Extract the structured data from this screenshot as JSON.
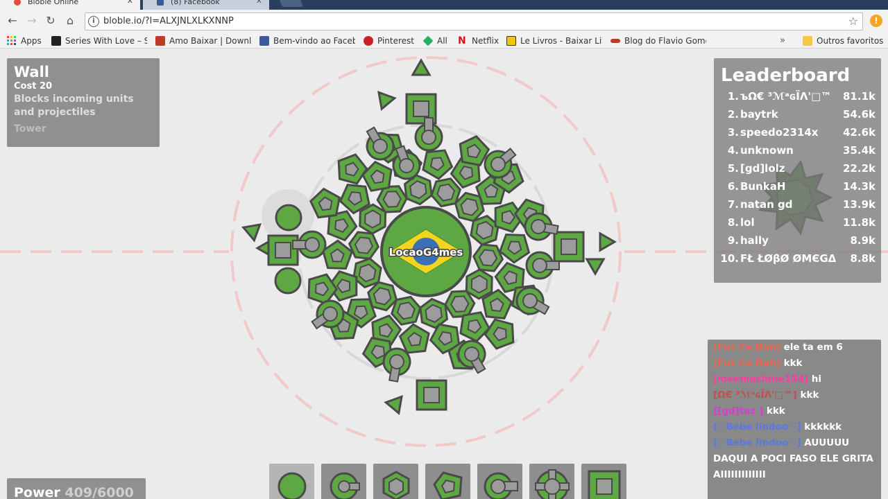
{
  "browser": {
    "tabs": [
      {
        "title": "Bloble Online",
        "active": true
      },
      {
        "title": "(8) Facebook",
        "active": false
      }
    ],
    "url": "bloble.io/?l=ALXJNLXLKXNNP",
    "bookmarks": [
      {
        "label": "Apps",
        "icon": "apps-grid-icon"
      },
      {
        "label": "Series With Love – Se",
        "icon": "film-icon"
      },
      {
        "label": "Amo Baixar | Downlo",
        "icon": "heart-icon"
      },
      {
        "label": "Bem-vindo ao Facebo",
        "icon": "facebook-icon"
      },
      {
        "label": "Pinterest",
        "icon": "pinterest-icon"
      },
      {
        "label": "All",
        "icon": "diamond-icon"
      },
      {
        "label": "Netflix",
        "icon": "netflix-icon"
      },
      {
        "label": "Le Livros - Baixar Livr",
        "icon": "book-icon"
      },
      {
        "label": "Blog do Flavio Gome",
        "icon": "car-icon"
      }
    ],
    "bookmarks_more": "»",
    "other_bookmarks": "Outros favoritos"
  },
  "info_panel": {
    "title": "Wall",
    "cost": "Cost 20",
    "description": "Blocks incoming units and projectiles",
    "type": "Tower"
  },
  "leaderboard": {
    "title": "Leaderboard",
    "rows": [
      {
        "rank": "1.",
        "name": "ъΩ€ ³ℳᵃɢЇΛ'□™",
        "score": "81.1k"
      },
      {
        "rank": "2.",
        "name": "baytrk",
        "score": "54.6k"
      },
      {
        "rank": "3.",
        "name": "speedo2314x",
        "score": "42.6k"
      },
      {
        "rank": "4.",
        "name": "unknown",
        "score": "35.4k"
      },
      {
        "rank": "5.",
        "name": "[gd]lolz",
        "score": "22.2k"
      },
      {
        "rank": "6.",
        "name": "BunkaH",
        "score": "14.3k"
      },
      {
        "rank": "7.",
        "name": "natan gd",
        "score": "13.9k"
      },
      {
        "rank": "8.",
        "name": "lol",
        "score": "11.8k"
      },
      {
        "rank": "9.",
        "name": "hally",
        "score": "8.9k"
      },
      {
        "rank": "10.",
        "name": "FŁ ŁØβØ ØMЄGΔ",
        "score": "8.8k"
      }
    ]
  },
  "chat": [
    {
      "author": "[Fus Ca Dah]",
      "text": " ele ta em 6",
      "color": "#e8634c"
    },
    {
      "author": "[Fus Ca Dah]",
      "text": " kkk",
      "color": "#e8634c"
    },
    {
      "author": "[meemachine184]",
      "text": " hi",
      "color": "#ff3ea5"
    },
    {
      "author": "[ΩЄ ³ℳᵃɢЇΛ'□™]",
      "text": " kkk",
      "color": "#c0504d"
    },
    {
      "author": "[[gd]taz ]",
      "text": " kkk",
      "color": "#d63bd6"
    },
    {
      "author": "[♡Bebe lindoo♡]",
      "text": " kkkkkk",
      "color": "#5a78e0"
    },
    {
      "author": "[♡Bebe lindoo♡]",
      "text": " AUUUUU DAQUI A POCI FASO ELE GRITA AIIIIIIIIIIIII",
      "color": "#5a78e0"
    }
  ],
  "player": {
    "name": "LocaoG4mes",
    "power_label": "Power",
    "power_value": "409/6000"
  },
  "colors": {
    "unit_green": "#5ea844",
    "outline": "#4a4a4a",
    "tower_grey": "#9c9c9c",
    "border_red": "#f2c9c9",
    "range_grey": "#d8d8d8"
  },
  "toolbar_slots": [
    {
      "name": "circle-slot",
      "selected": true
    },
    {
      "name": "turret-slot",
      "selected": false
    },
    {
      "name": "hexagon-slot",
      "selected": false
    },
    {
      "name": "pentagon-slot",
      "selected": false
    },
    {
      "name": "cannon-slot",
      "selected": false
    },
    {
      "name": "cross-turret-slot",
      "selected": false
    },
    {
      "name": "wall-slot",
      "selected": false
    }
  ]
}
